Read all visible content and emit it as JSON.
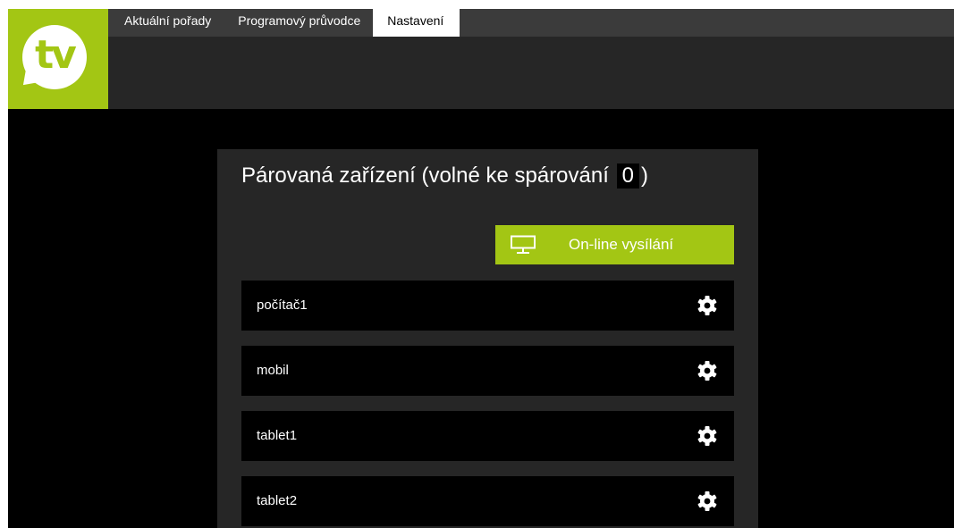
{
  "logo": {
    "text": "tv",
    "icon": "tv-logo-bubble"
  },
  "nav": {
    "tabs": [
      {
        "label": "Aktuální pořady",
        "active": false
      },
      {
        "label": "Programový průvodce",
        "active": false
      },
      {
        "label": "Nastavení",
        "active": true
      }
    ]
  },
  "panel": {
    "title_prefix": "Párovaná zařízení (volné ke spárování",
    "free_count": "0",
    "title_suffix": ")",
    "online_button": {
      "label": "On-line vysílání",
      "icon": "monitor-icon"
    },
    "devices": [
      {
        "name": "počítač1",
        "icon": "gear-icon"
      },
      {
        "name": "mobil",
        "icon": "gear-icon"
      },
      {
        "name": "tablet1",
        "icon": "gear-icon"
      },
      {
        "name": "tablet2",
        "icon": "gear-icon"
      }
    ]
  },
  "colors": {
    "accent": "#a3c614",
    "background": "#000000",
    "panel": "#262626",
    "tabbar": "#3b3b3b"
  }
}
